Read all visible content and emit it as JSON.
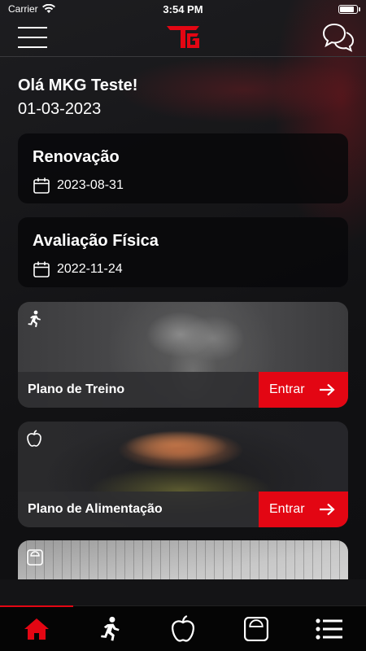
{
  "status_bar": {
    "carrier": "Carrier",
    "time": "3:54 PM",
    "battery_level": 0.85
  },
  "header": {
    "logo_icon": "tg-logo-icon",
    "menu_icon": "hamburger-menu-icon",
    "chat_icon": "chat-bubbles-icon"
  },
  "greeting": "Olá MKG Teste!",
  "today": "01-03-2023",
  "cards": [
    {
      "title": "Renovação",
      "date": "2023-08-31",
      "icon": "calendar-icon"
    },
    {
      "title": "Avaliação Física",
      "date": "2022-11-24",
      "icon": "calendar-icon"
    }
  ],
  "plans": [
    {
      "label": "Plano de Treino",
      "button": "Entrar",
      "icon": "runner-icon"
    },
    {
      "label": "Plano de Alimentação",
      "button": "Entrar",
      "icon": "apple-icon"
    },
    {
      "label": "",
      "button": "",
      "icon": "scale-icon"
    }
  ],
  "bottom_nav": [
    {
      "name": "home",
      "icon": "home-icon",
      "active": true
    },
    {
      "name": "treino",
      "icon": "runner-icon",
      "active": false
    },
    {
      "name": "alimentacao",
      "icon": "apple-icon",
      "active": false
    },
    {
      "name": "avaliacao",
      "icon": "scale-icon",
      "active": false
    },
    {
      "name": "mais",
      "icon": "list-icon",
      "active": false
    }
  ],
  "colors": {
    "accent": "#e30613",
    "background": "#141416",
    "card": "#08080a"
  }
}
